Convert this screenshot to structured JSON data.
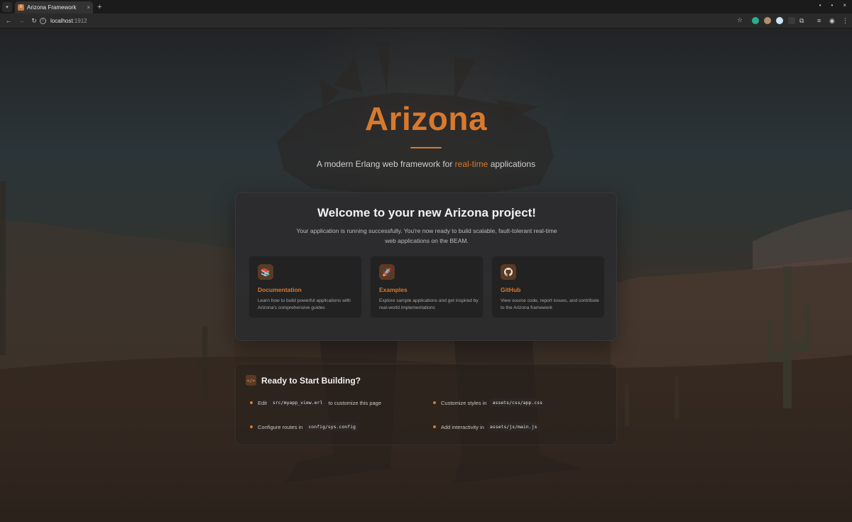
{
  "browser": {
    "tab_title": "Arizona Framework",
    "tab_close": "×",
    "new_tab": "+",
    "url_host": "localhost",
    "url_port": ":1912",
    "window_controls": [
      "•",
      "•",
      "×"
    ]
  },
  "hero": {
    "title": "Arizona",
    "subtitle_before": "A modern Erlang web framework for ",
    "subtitle_accent": "real-time",
    "subtitle_after": " applications"
  },
  "welcome": {
    "title": "Welcome to your new Arizona project!",
    "description": "Your application is running successfully. You're now ready to build scalable, fault-tolerant real-time web applications on the BEAM.",
    "cards": [
      {
        "icon": "books-icon",
        "glyph": "📚",
        "label": "Documentation",
        "text": "Learn how to build powerful applications with Arizona's comprehensive guides"
      },
      {
        "icon": "rocket-icon",
        "glyph": "🚀",
        "label": "Examples",
        "text": "Explore sample applications and get inspired by real-world implementations"
      },
      {
        "icon": "github-icon",
        "glyph": "",
        "label": "GitHub",
        "text": "View source code, report issues, and contribute to the Arizona framework"
      }
    ]
  },
  "ready": {
    "icon_text": "</>",
    "title": "Ready to Start Building?",
    "steps": [
      {
        "before": "Edit",
        "code": "src/myapp_view.erl",
        "after": "to customize this page"
      },
      {
        "before": "Customize styles in",
        "code": "assets/css/app.css",
        "after": ""
      },
      {
        "before": "Configure routes in",
        "code": "config/sys.config",
        "after": ""
      },
      {
        "before": "Add interactivity in",
        "code": "assets/js/main.js",
        "after": ""
      }
    ]
  },
  "colors": {
    "accent": "#d9792d",
    "card_bg": "#2c2c2e",
    "page_bg": "#2a221c"
  }
}
